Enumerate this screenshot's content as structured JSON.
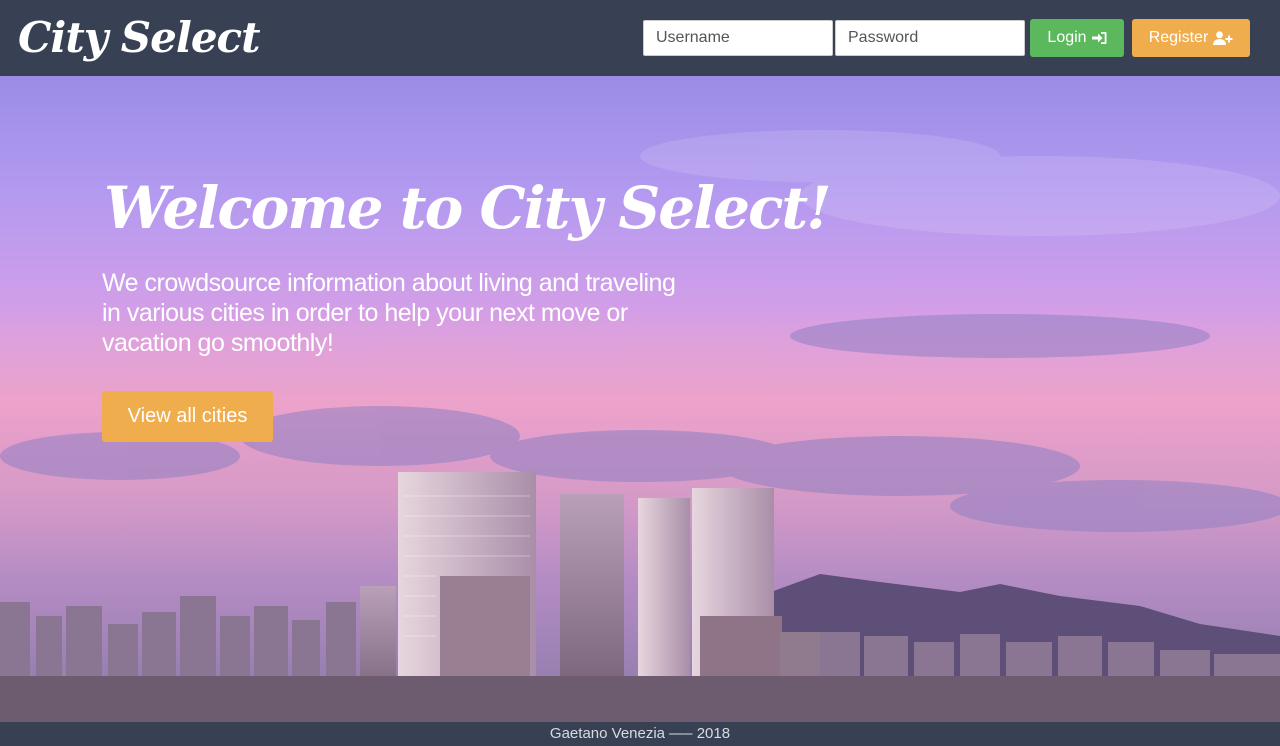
{
  "navbar": {
    "brand": "City Select",
    "username_placeholder": "Username",
    "password_placeholder": "Password",
    "login_label": "Login",
    "login_icon": "sign-in-icon",
    "register_label": "Register",
    "register_icon": "user-plus-icon"
  },
  "hero": {
    "title": "Welcome to City Select!",
    "lead": "We crowdsource information about living and traveling in various cities in order to help your next move or vacation go smoothly!",
    "cta_label": "View all cities",
    "background": "city-skyline-sunset-photo"
  },
  "footer": {
    "text": "Gaetano Venezia —– 2018"
  },
  "colors": {
    "navbar": "#374153",
    "login_button": "#5cb85c",
    "register_button": "#f0ad4e",
    "cta_button": "#f0ad4e"
  }
}
